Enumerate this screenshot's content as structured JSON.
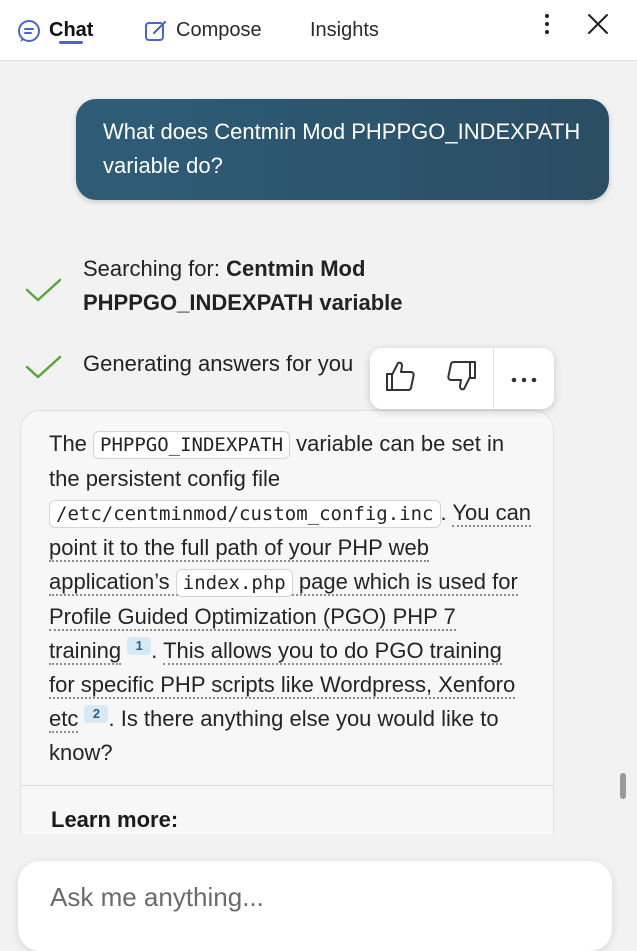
{
  "tabs": {
    "chat": "Chat",
    "compose": "Compose",
    "insights": "Insights"
  },
  "user_message": "What does Centmin Mod PHPPGO_INDEXPATH variable do?",
  "status": {
    "searching_prefix": "Searching for: ",
    "searching_query": "Centmin Mod PHPPGO_INDEXPATH variable",
    "generating": "Generating answers for you"
  },
  "answer": {
    "p1": "The ",
    "code1": "PHPPGO_INDEXPATH",
    "p2": " variable can be set in the persistent config file ",
    "code2": "/etc/centminmod/custom_config.inc",
    "p3": ". ",
    "s1a": "You can point it to the full path of your PHP web application’s ",
    "code3": "index.php",
    "s1b": " page which is used for Profile Guided Optimization (PGO) PHP 7 training",
    "cite1": "1",
    "p4": ". ",
    "s2": "This allows you to do PGO training for specific PHP scripts like Wordpress, Xenforo etc",
    "cite2": "2",
    "p5": ". Is there anything else you would like to know?"
  },
  "learn_more": "Learn more:",
  "input": {
    "placeholder": "Ask me anything..."
  },
  "colors": {
    "accent": "#4a67c7",
    "user_bubble": "#2e5d78",
    "check": "#5aa53b"
  },
  "icons": [
    "chat-icon",
    "compose-icon",
    "more-vertical-icon",
    "close-icon",
    "check-icon",
    "thumbs-up-icon",
    "thumbs-down-icon",
    "more-horizontal-icon"
  ]
}
